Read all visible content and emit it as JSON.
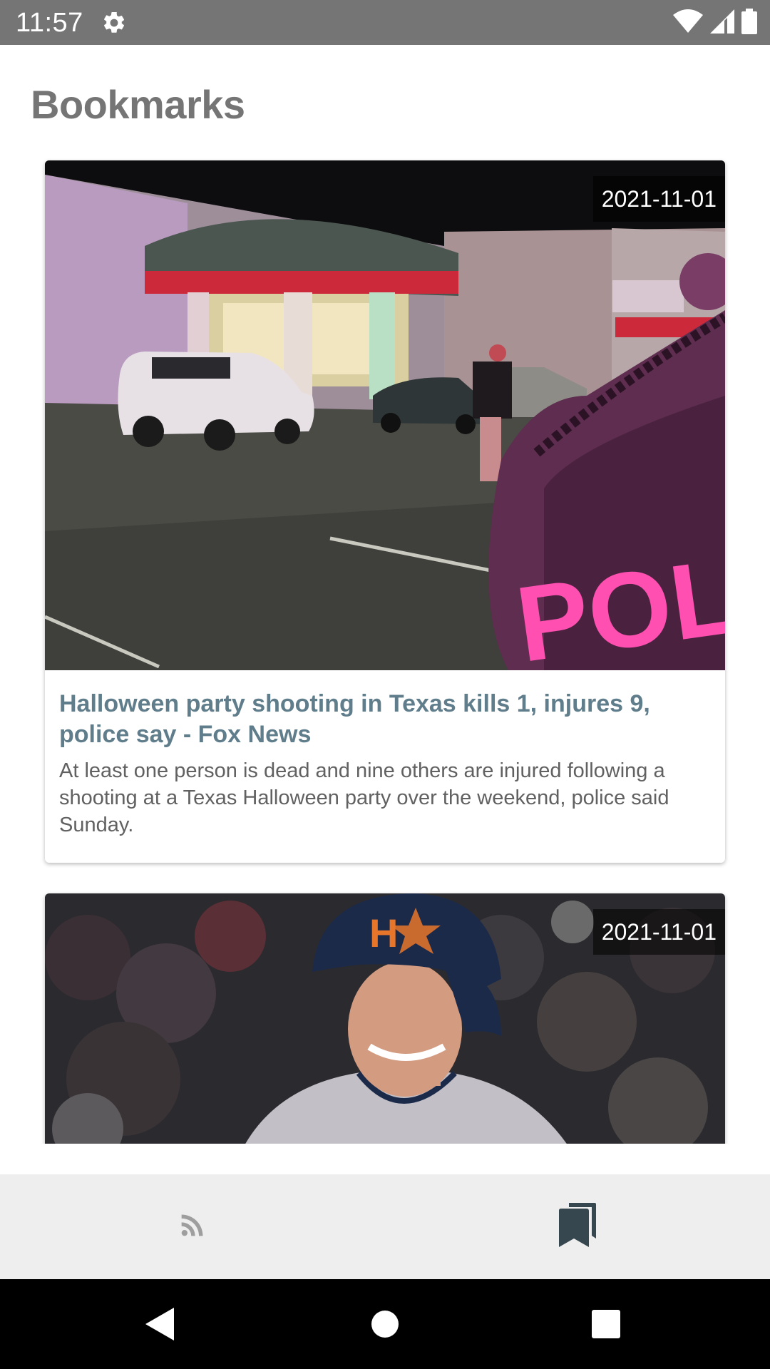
{
  "status_bar": {
    "time": "11:57",
    "icons": [
      "gear-icon",
      "wifi-icon",
      "signal-icon",
      "battery-icon"
    ]
  },
  "page": {
    "title": "Bookmarks"
  },
  "bookmarks": [
    {
      "date": "2021-11-01",
      "image": "night-parking-lot-police-photo",
      "title": "Halloween party shooting in Texas kills 1, injures 9, police say - Fox News",
      "description": "At least one person is dead and nine others are injured following a shooting at a Texas Halloween party over the weekend, police said Sunday."
    },
    {
      "date": "2021-11-01",
      "image": "baseball-player-photo"
    }
  ],
  "bottom_nav": {
    "items": [
      {
        "icon": "rss-feed-icon",
        "active": false
      },
      {
        "icon": "bookmarks-icon",
        "active": true
      }
    ],
    "colors": {
      "active": "#37474f",
      "inactive": "#9e9e9e",
      "background": "#eeeeee"
    }
  },
  "system_nav": {
    "icons": [
      "back-icon",
      "home-icon",
      "recents-icon"
    ]
  },
  "colors": {
    "title_accent": "#607d8b",
    "status_bar": "#757575",
    "page_title": "#757575"
  }
}
